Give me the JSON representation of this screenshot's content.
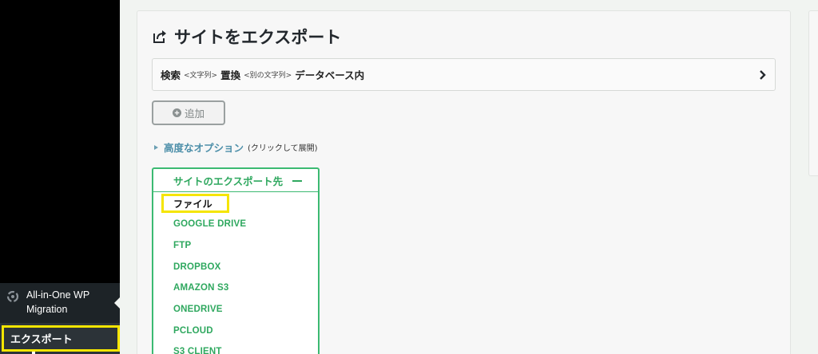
{
  "sidebar": {
    "plugin_label": "All-in-One WP Migration",
    "sub_item_label": "エクスポート"
  },
  "page": {
    "title": "サイトをエクスポート"
  },
  "search": {
    "find_label": "検索",
    "find_hint": "<文字列>",
    "replace_label": "置換",
    "replace_hint": "<別の文字列>",
    "scope_label": "データベース内"
  },
  "add_button": {
    "label": "追加"
  },
  "advanced": {
    "label": "高度なオプション",
    "hint": "(クリックして展開)"
  },
  "export_to": {
    "title": "サイトのエクスポート先",
    "items": [
      "ファイル",
      "GOOGLE DRIVE",
      "FTP",
      "DROPBOX",
      "AMAZON S3",
      "ONEDRIVE",
      "PCLOUD",
      "S3 CLIENT"
    ]
  },
  "colors": {
    "accent_green": "#2fa85f",
    "highlight_yellow": "#f5e500",
    "link_blue": "#4d8fa9"
  }
}
